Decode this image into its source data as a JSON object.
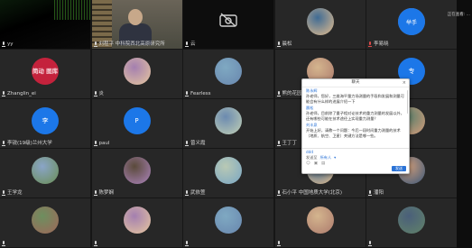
{
  "top_right_label": "正在查看: ...",
  "tiles": [
    {
      "name": "yy",
      "kind": "dark-video",
      "mic": "normal"
    },
    {
      "name": "刘程平 中科院西北高原研究所",
      "kind": "speaker-video",
      "mic": "normal"
    },
    {
      "name": "云",
      "kind": "camera-off",
      "mic": "normal"
    },
    {
      "name": "晨松",
      "kind": "avatar-photo",
      "mic": "normal"
    },
    {
      "name": "李易晓",
      "kind": "avatar-photo",
      "mic": "red",
      "button": "举手"
    },
    {
      "name": "Zhanglin_ei",
      "kind": "brand",
      "mic": "normal",
      "avatar_text": "简动 图库"
    },
    {
      "name": "炎",
      "kind": "avatar-photo",
      "mic": "normal"
    },
    {
      "name": "Fearless",
      "kind": "avatar-photo",
      "mic": "normal"
    },
    {
      "name": "熊的花园",
      "kind": "avatar-photo",
      "mic": "normal"
    },
    {
      "name": "翠",
      "kind": "blue-avatar",
      "mic": "normal",
      "avatar_text": "专"
    },
    {
      "name": "李锐(19级)兰州大学",
      "kind": "blue-avatar",
      "mic": "normal",
      "avatar_text": "李"
    },
    {
      "name": "paul",
      "kind": "blue-avatar",
      "mic": "normal",
      "avatar_text": "P"
    },
    {
      "name": "曾义霞",
      "kind": "avatar-photo",
      "mic": "normal"
    },
    {
      "name": "王丁丁",
      "kind": "avatar-photo",
      "mic": "normal"
    },
    {
      "name": "赵",
      "kind": "avatar-photo",
      "mic": "normal"
    },
    {
      "name": "王学龙",
      "kind": "avatar-photo",
      "mic": "normal"
    },
    {
      "name": "陈梦娴",
      "kind": "avatar-photo",
      "mic": "normal"
    },
    {
      "name": "武依萱",
      "kind": "avatar-photo",
      "mic": "normal"
    },
    {
      "name": "石小平 中国地质大学(北京)",
      "kind": "avatar-photo",
      "mic": "normal"
    },
    {
      "name": "潘阳",
      "kind": "avatar-photo",
      "mic": "normal"
    },
    {
      "name": "",
      "kind": "avatar-photo",
      "mic": "normal"
    },
    {
      "name": "",
      "kind": "avatar-photo",
      "mic": "normal"
    },
    {
      "name": "",
      "kind": "avatar-photo",
      "mic": "normal"
    },
    {
      "name": "",
      "kind": "avatar-photo",
      "mic": "normal"
    },
    {
      "name": "",
      "kind": "avatar-photo",
      "mic": "normal"
    }
  ],
  "chat": {
    "title": "聊天",
    "close_icon": "×",
    "messages": [
      {
        "sender": "陈永辉",
        "text": "孙老师，您好，三维海平量力场测量的手段和发展和测量可能会有什么样的进展介绍一下"
      },
      {
        "sender": "晨松",
        "text": "孙老师，目前除了量子相对论技术的重力测量的发展以外，还有哪些可能在技术途径上实现重力测量？"
      },
      {
        "sender": "刘丰泉",
        "text": "开始上好，请教一个问题：今后一段时间重力测量的技术（地质、航空、卫星）关键方法是哪一些。"
      }
    ],
    "composer": {
      "placeholder": "ddd",
      "send_to_label": "发送至",
      "send_to_value": "所有人",
      "send_button": "发送",
      "icons": [
        "emoji-icon",
        "image-icon",
        "file-icon"
      ]
    }
  },
  "colors": {
    "chat_accent": "#2b73d6",
    "bg": "#161616",
    "tile": "#272727",
    "raise_hand": "#1c77e8"
  }
}
